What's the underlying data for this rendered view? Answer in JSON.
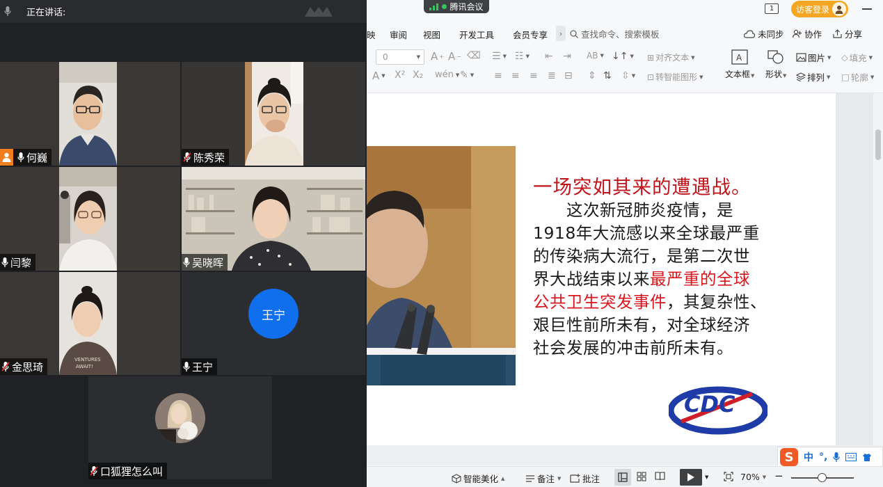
{
  "meeting": {
    "speaking_label": "正在讲话:",
    "participants": [
      {
        "name": "何巍",
        "host": true,
        "muted": false
      },
      {
        "name": "陈秀荣",
        "host": false,
        "muted": true
      },
      {
        "name": "闫黎",
        "host": false,
        "muted": false
      },
      {
        "name": "吴晓晖",
        "host": false,
        "muted": false
      },
      {
        "name": "金思琦",
        "host": false,
        "muted": true
      },
      {
        "name": "王宁",
        "host": false,
        "muted": false,
        "avatar_text": "王宁"
      },
      {
        "name": "口狐狸怎么叫",
        "host": false,
        "muted": true
      }
    ]
  },
  "app": {
    "titlebar": {
      "tencent_meeting": "腾讯会议",
      "page_indicator": "1",
      "login_label": "访客登录"
    },
    "menu": {
      "items": [
        "映",
        "审阅",
        "视图",
        "开发工具",
        "会员专享"
      ],
      "more": "›",
      "search_placeholder": "查找命令、搜索模板",
      "unsync": "未同步",
      "collab": "协作",
      "share": "分享"
    },
    "toolbar": {
      "font_size": "0",
      "align_text": "对齐文本",
      "smart_shape": "转智能图形",
      "textbox": "文本框",
      "shape": "形状",
      "picture": "图片",
      "arrange": "排列",
      "fill": "填充",
      "outline": "轮廓"
    },
    "slide": {
      "headline": "一场突如其来的遭遇战。",
      "body_lines": [
        [
          "　　这次新冠肺炎疫情，是"
        ],
        [
          "1918年大流感以来全球最严重"
        ],
        [
          "的传染病大流行，是第二次世"
        ],
        [
          "界大战结束以来",
          "最严重的全球"
        ],
        [
          "公共卫生突发事件",
          "，其复杂性、"
        ],
        [
          "艰巨性前所未有，对全球经济"
        ],
        [
          "社会发展的冲击前所未有。"
        ]
      ],
      "logo_text": "CDC"
    },
    "ime": {
      "logo": "S",
      "mode": "中",
      "punct": "°,"
    },
    "statusbar": {
      "beautify": "智能美化",
      "notes": "备注",
      "comments": "批注",
      "zoom": "70%",
      "zoom_minus": "−"
    }
  },
  "colors": {
    "accent_orange": "#f5a623",
    "host_badge": "#f07e1f",
    "avatar_blue": "#0f6fec",
    "slide_red": "#d9161c",
    "tm_green": "#2fc85b"
  }
}
